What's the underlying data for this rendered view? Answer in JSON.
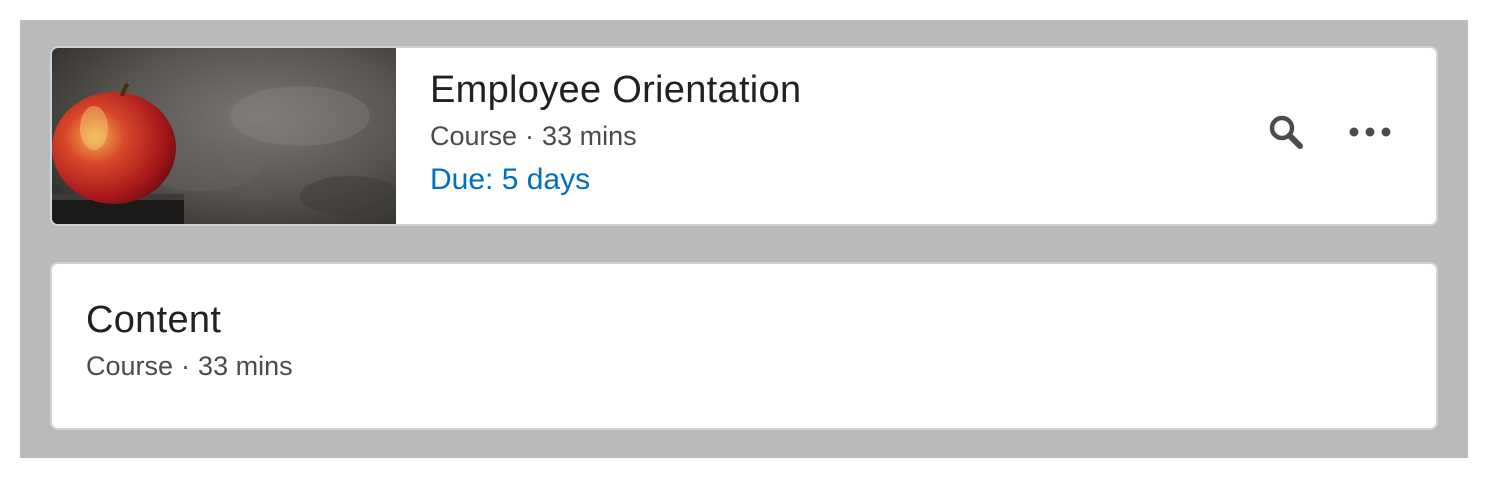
{
  "courses": [
    {
      "title": "Employee Orientation",
      "type": "Course",
      "separator": "·",
      "duration": "33 mins",
      "due": "Due: 5 days",
      "thumbnail": "apple-on-books-image",
      "actions": [
        "search-icon",
        "more-options-icon"
      ]
    },
    {
      "title": "Content",
      "type": "Course",
      "separator": "·",
      "duration": "33 mins"
    }
  ],
  "colors": {
    "background_panel": "#bababa",
    "card_border": "#cdd5dc",
    "due_text": "#006fbf",
    "title_text": "#202122",
    "meta_text": "#494c4e",
    "icon": "#494c4e"
  }
}
